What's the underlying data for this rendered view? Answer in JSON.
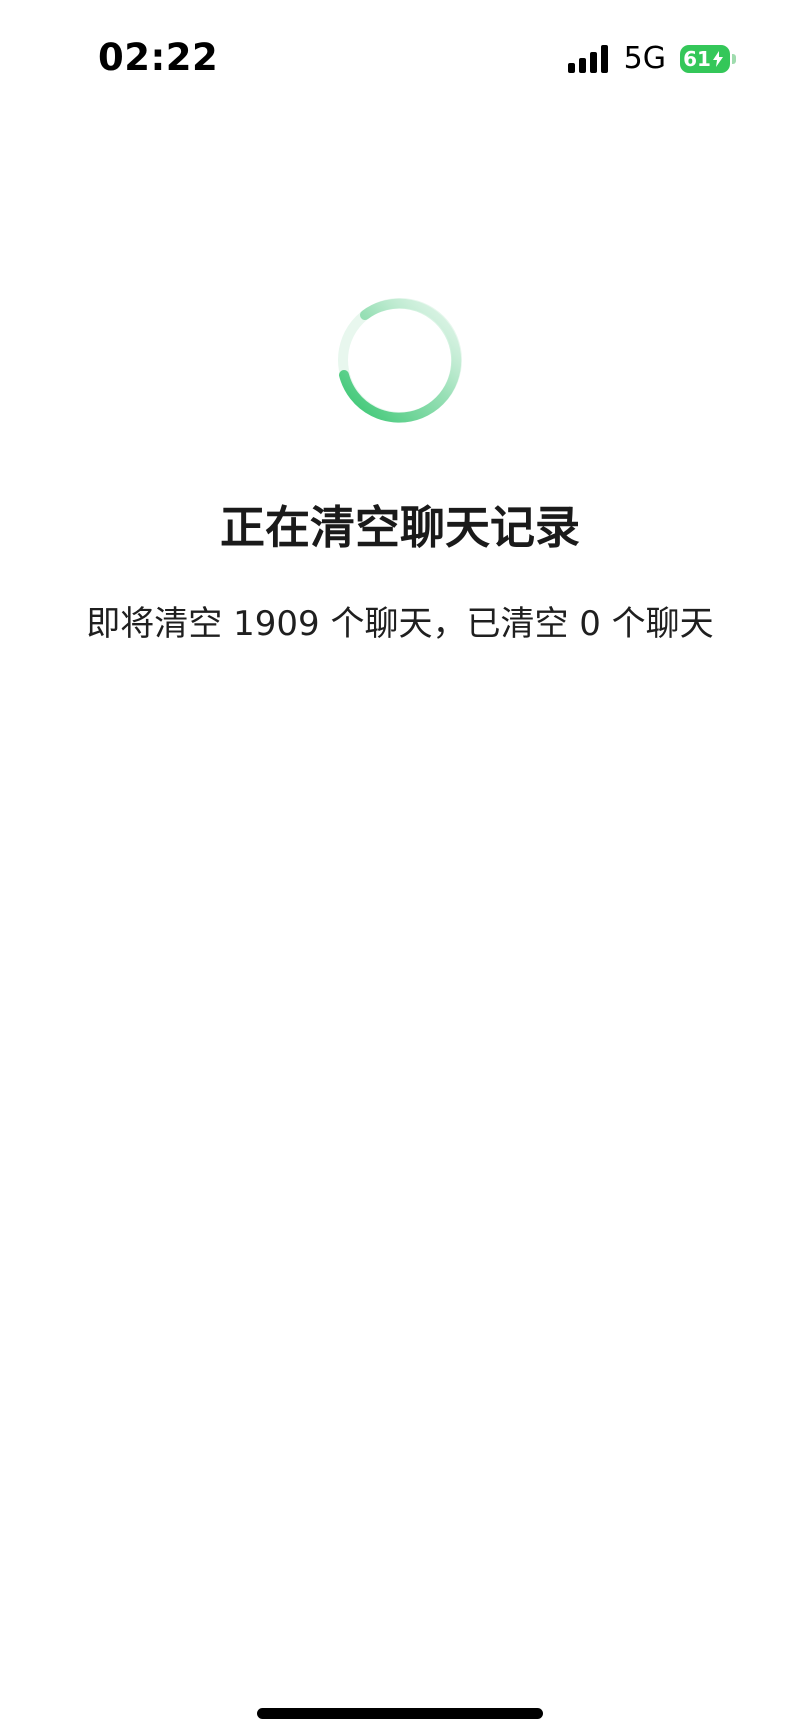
{
  "status_bar": {
    "time": "02:22",
    "network": "5G",
    "battery_level": "61",
    "battery_charging": true,
    "signal_bars": 4
  },
  "spinner": {
    "icon": "loading-spinner-icon",
    "color": "#2fc46b"
  },
  "main": {
    "title": "正在清空聊天记录",
    "subtitle": "即将清空 1909 个聊天，已清空 0 个聊天"
  },
  "colors": {
    "accent": "#2fc46b",
    "battery": "#34c759",
    "text": "#1a1a1a",
    "background": "#ffffff"
  }
}
